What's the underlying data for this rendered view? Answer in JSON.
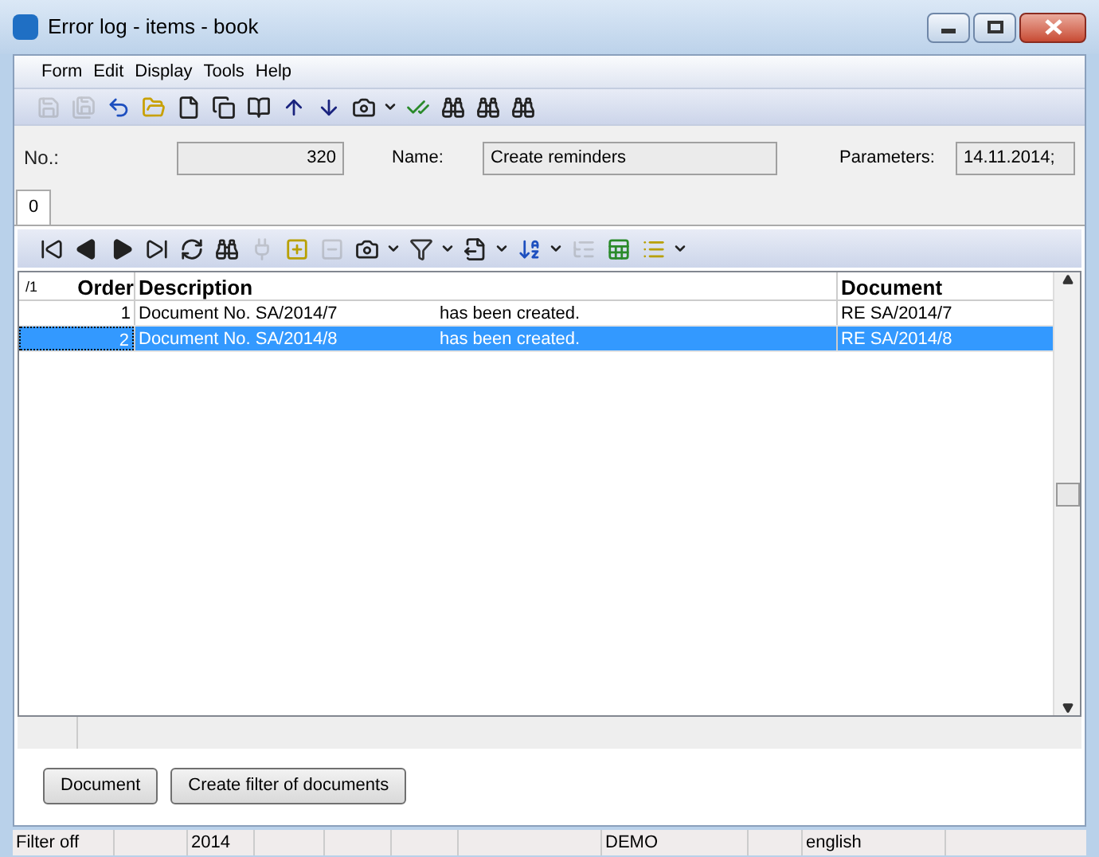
{
  "window": {
    "title": "Error log - items - book"
  },
  "menu": [
    "Form",
    "Edit",
    "Display",
    "Tools",
    "Help"
  ],
  "main_toolbar": [
    {
      "kind": "save",
      "disabled": true
    },
    {
      "kind": "save-as",
      "disabled": true
    },
    {
      "kind": "undo",
      "disabled": false
    },
    {
      "kind": "open",
      "disabled": false
    },
    {
      "kind": "new",
      "disabled": false
    },
    {
      "kind": "copy",
      "disabled": false
    },
    {
      "kind": "book",
      "disabled": false
    },
    {
      "kind": "up",
      "disabled": false
    },
    {
      "kind": "down",
      "disabled": false
    },
    {
      "kind": "camera",
      "disabled": false
    },
    {
      "kind": "dropdown",
      "disabled": false
    },
    {
      "kind": "check",
      "disabled": false
    },
    {
      "kind": "find",
      "disabled": false
    },
    {
      "kind": "find",
      "disabled": false
    },
    {
      "kind": "find",
      "disabled": false
    }
  ],
  "header": {
    "no_label": "No.:",
    "no_value": "320",
    "name_label": "Name:",
    "name_value": "Create reminders",
    "parameters_label": "Parameters:",
    "parameters_value": "14.11.2014;"
  },
  "tabs": [
    {
      "label": "0",
      "selected": true
    }
  ],
  "grid_toolbar": [
    {
      "kind": "first",
      "disabled": false
    },
    {
      "kind": "prev",
      "disabled": false
    },
    {
      "kind": "next",
      "disabled": false
    },
    {
      "kind": "last",
      "disabled": false
    },
    {
      "kind": "refresh",
      "disabled": false
    },
    {
      "kind": "find",
      "disabled": false
    },
    {
      "kind": "plug",
      "disabled": true
    },
    {
      "kind": "add",
      "disabled": false
    },
    {
      "kind": "remove",
      "disabled": true
    },
    {
      "kind": "camera",
      "disabled": false
    },
    {
      "kind": "dropdown",
      "disabled": false
    },
    {
      "kind": "filter",
      "disabled": false
    },
    {
      "kind": "dropdown",
      "disabled": false
    },
    {
      "kind": "export",
      "disabled": false
    },
    {
      "kind": "dropdown",
      "disabled": false
    },
    {
      "kind": "sort",
      "disabled": false
    },
    {
      "kind": "dropdown",
      "disabled": false
    },
    {
      "kind": "tree",
      "disabled": true
    },
    {
      "kind": "excel",
      "disabled": false
    },
    {
      "kind": "list",
      "disabled": false
    },
    {
      "kind": "dropdown",
      "disabled": false
    }
  ],
  "table": {
    "sort_indicator": "/1",
    "columns": [
      "Order",
      "Description",
      "Document"
    ],
    "rows": [
      {
        "order": "1",
        "description": "Document No. SA/2014/7",
        "message": "has been created.",
        "document": "RE SA/2014/7",
        "selected": false
      },
      {
        "order": "2",
        "description": "Document No. SA/2014/8",
        "message": "has been created.",
        "document": "RE SA/2014/8",
        "selected": true
      }
    ]
  },
  "buttons": [
    "Document",
    "Create filter of documents"
  ],
  "status_bar": [
    "Filter off",
    "2014",
    "DEMO",
    "english"
  ]
}
